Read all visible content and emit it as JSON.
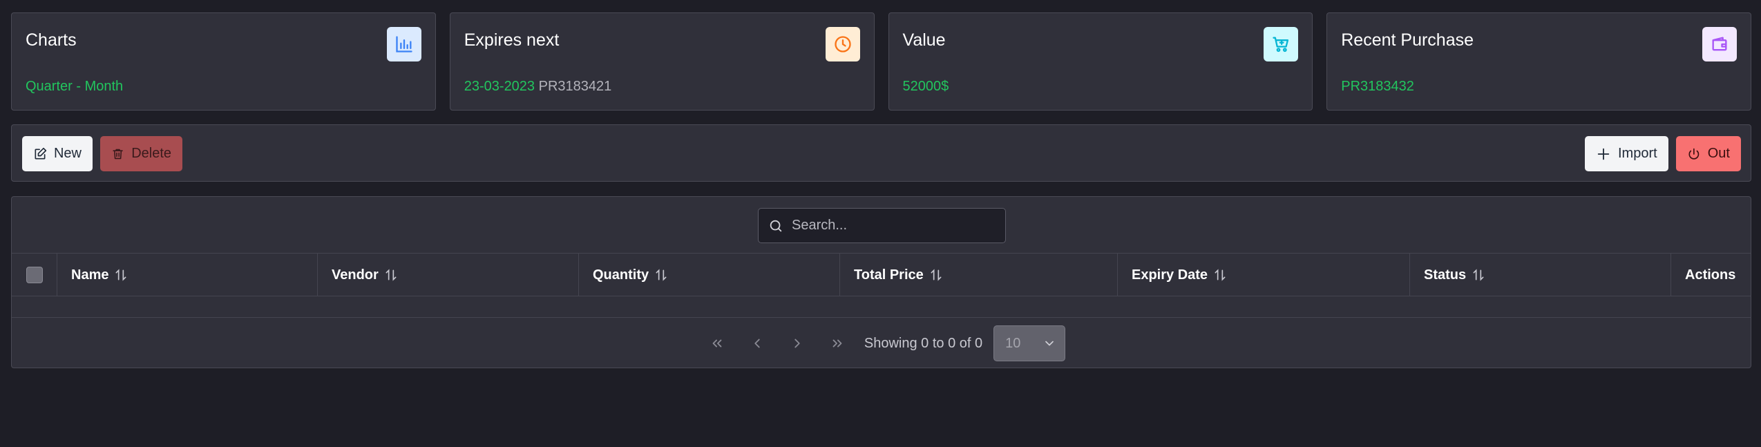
{
  "cards": [
    {
      "title": "Charts",
      "sub_green": "Quarter - Month",
      "sub_muted": "",
      "icon": "bar-chart-icon",
      "icon_bg": "#dbeafe",
      "icon_color": "#3b82f6"
    },
    {
      "title": "Expires next",
      "sub_green": "23-03-2023",
      "sub_muted": "PR3183421",
      "icon": "clock-icon",
      "icon_bg": "#ffedd5",
      "icon_color": "#f97316"
    },
    {
      "title": "Value",
      "sub_green": "52000$",
      "sub_muted": "",
      "icon": "cart-icon",
      "icon_bg": "#cffafe",
      "icon_color": "#06b6d4"
    },
    {
      "title": "Recent Purchase",
      "sub_green": "PR3183432",
      "sub_muted": "",
      "icon": "wallet-icon",
      "icon_bg": "#f3e8ff",
      "icon_color": "#a855f7"
    }
  ],
  "toolbar": {
    "new_label": "New",
    "delete_label": "Delete",
    "import_label": "Import",
    "out_label": "Out"
  },
  "search": {
    "placeholder": "Search..."
  },
  "table": {
    "columns": [
      "Name",
      "Vendor",
      "Quantity",
      "Total Price",
      "Expiry Date",
      "Status",
      "Actions"
    ]
  },
  "pager": {
    "summary": "Showing 0 to 0 of 0",
    "rows_per_page": "10"
  },
  "colors": {
    "accent_green": "#22c55e",
    "danger": "#f87171"
  }
}
